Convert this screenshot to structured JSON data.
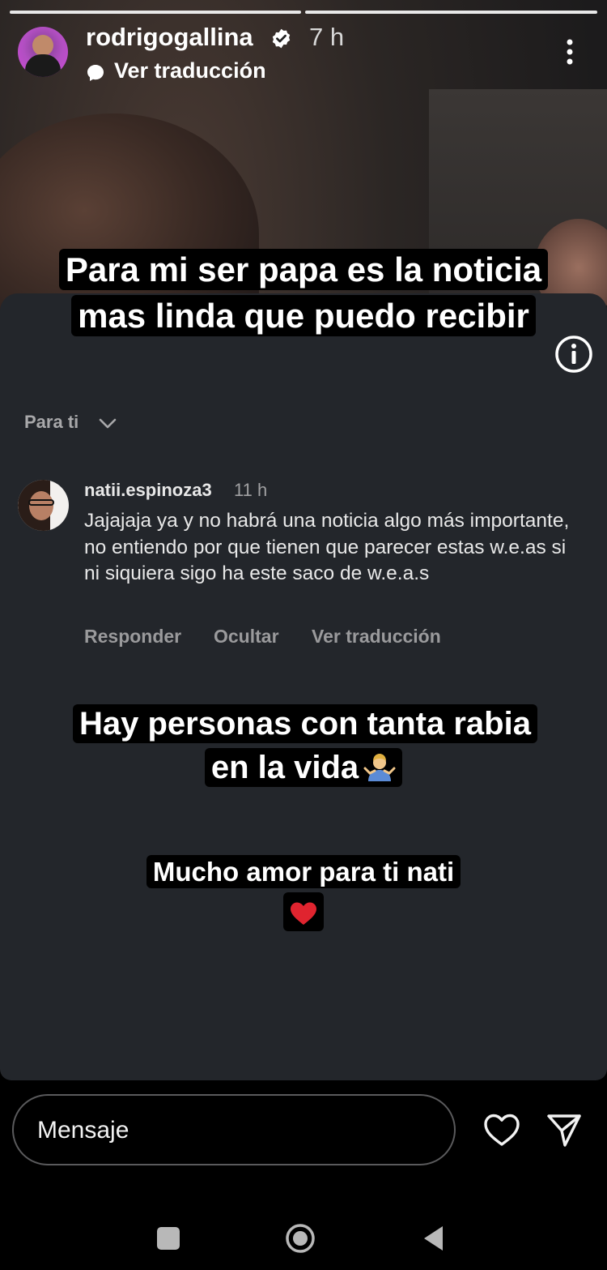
{
  "story": {
    "username": "rodrigogallina",
    "time_ago": "7 h",
    "translate_label": "Ver traducción",
    "caption_top": "Para mi ser papa es la noticia mas linda que puedo recibir",
    "caption_middle": "Hay personas con tanta rabia en la vida",
    "caption_bottom": "Mucho amor para ti nati",
    "progress_segments": 2
  },
  "comment_card": {
    "section_label": "Para ti",
    "comment": {
      "username": "natii.espinoza3",
      "time_ago": "11 h",
      "text": "Jajajaja ya y no habrá una noticia algo más importante, no entiendo por que tienen que parecer estas w.e.as si ni siquiera sigo ha este saco de w.e.a.s",
      "actions": {
        "reply": "Responder",
        "hide": "Ocultar",
        "translate": "Ver traducción"
      }
    }
  },
  "reply_bar": {
    "placeholder": "Mensaje"
  },
  "icons": {
    "verified": "verified-badge-icon",
    "more": "more-vertical-icon",
    "info": "info-icon",
    "heart": "heart-icon",
    "send": "send-icon",
    "shrug_emoji": "person-shrugging-emoji",
    "heart_emoji": "red-heart-emoji"
  },
  "colors": {
    "card_bg": "#23262b",
    "accent_text": "#ffffff",
    "muted_text": "#9a9a9c",
    "heart_emoji": "#e0242f"
  }
}
